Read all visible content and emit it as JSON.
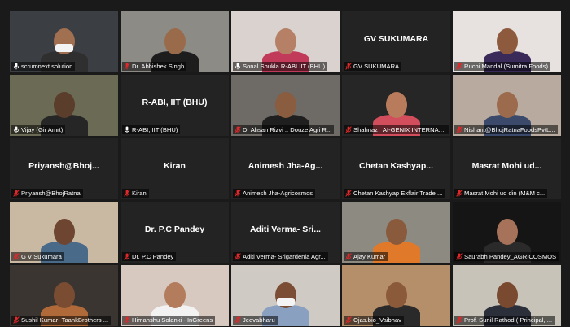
{
  "meeting": {
    "participants": [
      {
        "label": "scrumnext solution",
        "center_name": "",
        "muted": false,
        "has_video": true,
        "active": false,
        "bg": "#3b3f44",
        "skin": "#a07050",
        "shirt": "#2f2f2f",
        "mask": true
      },
      {
        "label": "Dr. Abhishek Singh",
        "center_name": "",
        "muted": true,
        "has_video": true,
        "active": false,
        "bg": "#8c8b86",
        "skin": "#9a6b4a",
        "shirt": "#1d1d1d"
      },
      {
        "label": "Sonal Shukla R-ABI IIT (BHU)",
        "center_name": "",
        "muted": false,
        "has_video": true,
        "active": false,
        "bg": "#d9d2cf",
        "skin": "#b58066",
        "shirt": "#c23a5a"
      },
      {
        "label": "GV SUKUMARA",
        "center_name": "GV SUKUMARA",
        "muted": true,
        "has_video": false,
        "active": false
      },
      {
        "label": "Ruchi Mandal (Sumitra Foods)",
        "center_name": "",
        "muted": true,
        "has_video": true,
        "active": false,
        "bg": "#e7e2df",
        "skin": "#8e5a3d",
        "shirt": "#3a2a5a"
      },
      {
        "label": "Vijay (Gir Amrt)",
        "center_name": "",
        "muted": false,
        "has_video": true,
        "active": true,
        "bg": "#6b6a55",
        "skin": "#5a3d2b",
        "shirt": "#262626"
      },
      {
        "label": "R-ABI, IIT (BHU)",
        "center_name": "R-ABI, IIT (BHU)",
        "muted": false,
        "has_video": false,
        "active": false
      },
      {
        "label": "Dr Ahsan Rizvi :: Douze Agri R...",
        "center_name": "",
        "muted": true,
        "has_video": true,
        "active": false,
        "bg": "#6e6a66",
        "skin": "#8a5c40",
        "shirt": "#1f1f1f"
      },
      {
        "label": "Shahnaz_ AI-GENIX INTERNAT...",
        "center_name": "",
        "muted": true,
        "has_video": true,
        "active": false,
        "bg": "#262626",
        "skin": "#b87b5b",
        "shirt": "#d24e5c"
      },
      {
        "label": "Nishant@BhojRatnaFoodsPvtL...",
        "center_name": "",
        "muted": true,
        "has_video": true,
        "active": false,
        "bg": "#b9aaa0",
        "skin": "#9c6a4c",
        "shirt": "#3b4a6a"
      },
      {
        "label": "Priyansh@BhojRatna",
        "center_name": "Priyansh@Bhoj...",
        "muted": true,
        "has_video": false,
        "active": false
      },
      {
        "label": "Kiran",
        "center_name": "Kiran",
        "muted": true,
        "has_video": false,
        "active": false
      },
      {
        "label": "Animesh Jha-Agricosmos",
        "center_name": "Animesh Jha-Ag...",
        "muted": true,
        "has_video": false,
        "active": false
      },
      {
        "label": "Chetan Kashyap Exflair Trade ...",
        "center_name": "Chetan Kashyap...",
        "muted": true,
        "has_video": false,
        "active": false
      },
      {
        "label": "Masrat Mohi ud din (M&M c...",
        "center_name": "Masrat Mohi ud...",
        "muted": true,
        "has_video": false,
        "active": false
      },
      {
        "label": "G V Sukumara",
        "center_name": "",
        "muted": true,
        "has_video": true,
        "active": false,
        "bg": "#c9b9a3",
        "skin": "#6e4530",
        "shirt": "#4a6a8a"
      },
      {
        "label": "Dr. P.C Pandey",
        "center_name": "Dr. P.C Pandey",
        "muted": true,
        "has_video": false,
        "active": false
      },
      {
        "label": "Aditi Verma- Srigardenia Agr...",
        "center_name": "Aditi Verma- Sri...",
        "muted": true,
        "has_video": false,
        "active": false
      },
      {
        "label": "Ajay Kumar",
        "center_name": "",
        "muted": true,
        "has_video": true,
        "active": false,
        "bg": "#8d8a82",
        "skin": "#8a5a3c",
        "shirt": "#e07a2a"
      },
      {
        "label": "Saurabh Pandey_AGRICOSMOS",
        "center_name": "",
        "muted": true,
        "has_video": true,
        "active": false,
        "bg": "#151515",
        "skin": "#a7725a",
        "shirt": "#2a2a2a"
      },
      {
        "label": "Sushil Kumar- TaankBrothers ...",
        "center_name": "",
        "muted": true,
        "has_video": true,
        "active": false,
        "bg": "#3a3531",
        "skin": "#7a4c32",
        "shirt": "#b06a3a"
      },
      {
        "label": "Himanshu Solanki - InGreens",
        "center_name": "",
        "muted": true,
        "has_video": true,
        "active": false,
        "bg": "#d7c8c0",
        "skin": "#b27c5d",
        "shirt": "#f2f2f2"
      },
      {
        "label": "Jeevabharu",
        "center_name": "",
        "muted": true,
        "has_video": true,
        "active": false,
        "bg": "#cfcbc4",
        "skin": "#7b4d34",
        "shirt": "#8aa0c0",
        "mask": true
      },
      {
        "label": "Ojas.bio_Vaibhav",
        "center_name": "",
        "muted": true,
        "has_video": true,
        "active": false,
        "bg": "#b58e6a",
        "skin": "#8a5a3a",
        "shirt": "#2a2a2a"
      },
      {
        "label": "Prof. Sunil Rathod ( Principal, ...",
        "center_name": "",
        "muted": true,
        "has_video": true,
        "active": false,
        "bg": "#c8c3b9",
        "skin": "#7a4a30",
        "shirt": "#2b2f3a"
      }
    ]
  }
}
